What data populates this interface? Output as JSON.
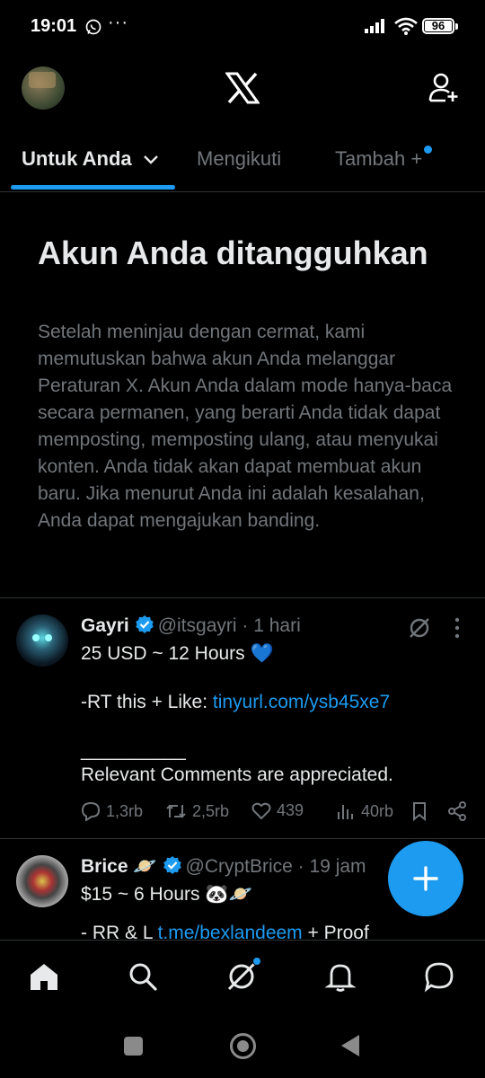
{
  "status_bar": {
    "time": "19:01",
    "more_dots": "···",
    "battery": "96"
  },
  "tabs": [
    {
      "label": "Untuk Anda"
    },
    {
      "label": "Mengikuti"
    },
    {
      "label": "Tambah +"
    }
  ],
  "notice": {
    "title": "Akun Anda ditangguhkan",
    "body": "Setelah meninjau dengan cermat, kami memutuskan bahwa akun Anda melanggar Peraturan X. Akun Anda dalam mode hanya-baca secara permanen, yang berarti Anda tidak dapat memposting, memposting ulang, atau menyukai konten. Anda tidak akan dapat membuat akun baru. Jika menurut Anda ini adalah kesalahan, Anda dapat mengajukan banding."
  },
  "posts": [
    {
      "name": "Gayri",
      "handle": "@itsgayri · 1 hari",
      "line1": "25 USD ~ 12 Hours 💙",
      "line2_prefix": "-RT this + Like: ",
      "line2_link": "tinyurl.com/ysb45xe7",
      "divider": "__________",
      "line3": "Relevant Comments are appreciated.",
      "replies": "1,3rb",
      "reposts": "2,5rb",
      "likes": "439",
      "views": "40rb"
    },
    {
      "name": "Brice 🪐",
      "handle": "@CryptBrice · 19 jam",
      "line1": "$15 ~ 6 Hours 🐼🪐",
      "cut_prefix": "- RR & L ",
      "cut_link": "t.me/bexlandeem",
      "cut_suffix": " + Proof"
    }
  ],
  "colors": {
    "accent": "#1d9bf0",
    "text": "#e7e9ea",
    "muted": "#71767b",
    "border": "#2f3336"
  },
  "icons": {
    "header": [
      "avatar",
      "x-logo-icon",
      "add-user-icon"
    ],
    "bottom_nav": [
      "home-icon",
      "search-icon",
      "grok-icon",
      "bell-icon",
      "message-icon"
    ],
    "fab": "plus-icon"
  }
}
